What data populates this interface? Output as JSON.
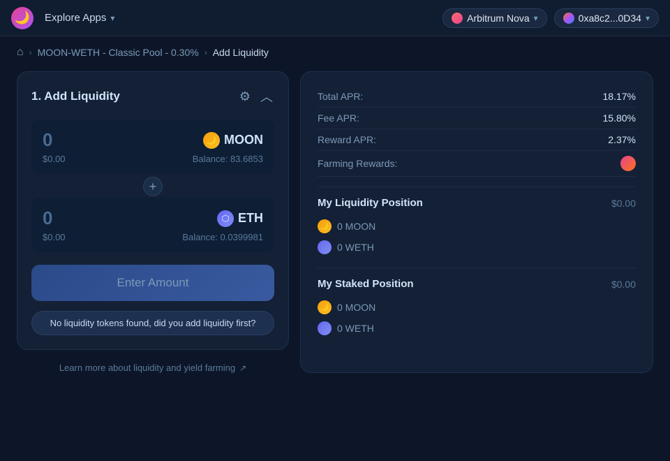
{
  "topnav": {
    "logo_emoji": "🌙",
    "explore_apps_label": "Explore Apps",
    "network": {
      "name": "Arbitrum Nova",
      "icon": "N"
    },
    "wallet": {
      "address": "0xa8c2...0D34"
    }
  },
  "breadcrumb": {
    "home_icon": "⌂",
    "pool_link": "MOON-WETH - Classic Pool - 0.30%",
    "current": "Add Liquidity"
  },
  "add_liquidity_card": {
    "title": "1. Add Liquidity",
    "token_a": {
      "amount": "0",
      "usd_value": "$0.00",
      "name": "MOON",
      "balance_label": "Balance:",
      "balance": "83.6853"
    },
    "plus_symbol": "+",
    "token_b": {
      "amount": "0",
      "usd_value": "$0.00",
      "name": "ETH",
      "balance_label": "Balance:",
      "balance": "0.0399981"
    },
    "enter_amount_button": "Enter Amount",
    "tooltip": "No liquidity tokens found, did you add liquidity first?",
    "learn_more": "Learn more about liquidity and yield farming",
    "learn_more_icon": "↗"
  },
  "right_panel": {
    "total_apr_label": "Total APR:",
    "total_apr_value": "18.17%",
    "fee_apr_label": "Fee APR:",
    "fee_apr_value": "15.80%",
    "reward_apr_label": "Reward APR:",
    "reward_apr_value": "2.37%",
    "farming_rewards_label": "Farming Rewards:",
    "my_liquidity_position": {
      "title": "My Liquidity Position",
      "value": "$0.00",
      "tokens": [
        {
          "name": "0 MOON",
          "type": "moon"
        },
        {
          "name": "0 WETH",
          "type": "weth"
        }
      ]
    },
    "my_staked_position": {
      "title": "My Staked Position",
      "value": "$0.00",
      "tokens": [
        {
          "name": "0 MOON",
          "type": "moon"
        },
        {
          "name": "0 WETH",
          "type": "weth"
        }
      ]
    }
  }
}
